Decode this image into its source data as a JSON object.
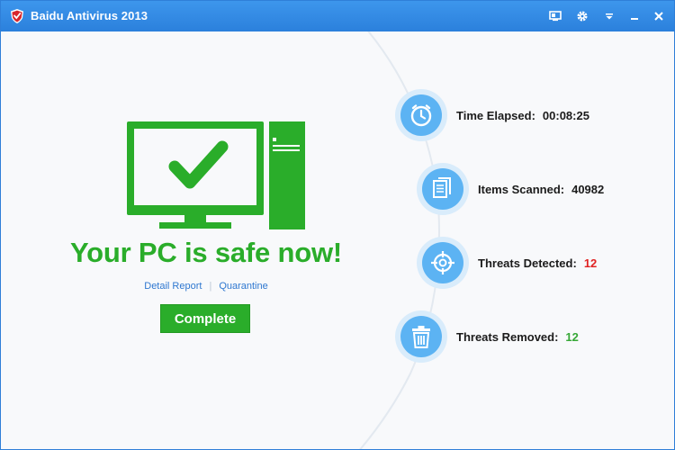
{
  "window": {
    "title": "Baidu Antivirus 2013"
  },
  "titlebar_controls": [
    {
      "name": "skin-icon"
    },
    {
      "name": "settings-icon"
    },
    {
      "name": "dropdown-icon"
    },
    {
      "name": "minimize-icon"
    },
    {
      "name": "close-icon"
    }
  ],
  "result": {
    "headline": "Your PC is safe now!",
    "detail_report_link": "Detail Report",
    "separator": "|",
    "quarantine_link": "Quarantine",
    "complete_button": "Complete"
  },
  "stats": {
    "time_elapsed": {
      "label": "Time Elapsed:",
      "value": "00:08:25",
      "icon": "clock-icon"
    },
    "items_scanned": {
      "label": "Items Scanned:",
      "value": "40982",
      "icon": "documents-icon"
    },
    "threats_detected": {
      "label": "Threats Detected:",
      "value": "12",
      "icon": "crosshair-icon"
    },
    "threats_removed": {
      "label": "Threats Removed:",
      "value": "12",
      "icon": "trash-icon"
    }
  },
  "colors": {
    "titlebar": "#2b80dc",
    "safe_green": "#2aad2a",
    "link_blue": "#2f78d0",
    "stat_circle": "#5cb3f3",
    "threat_red": "#e02222"
  }
}
